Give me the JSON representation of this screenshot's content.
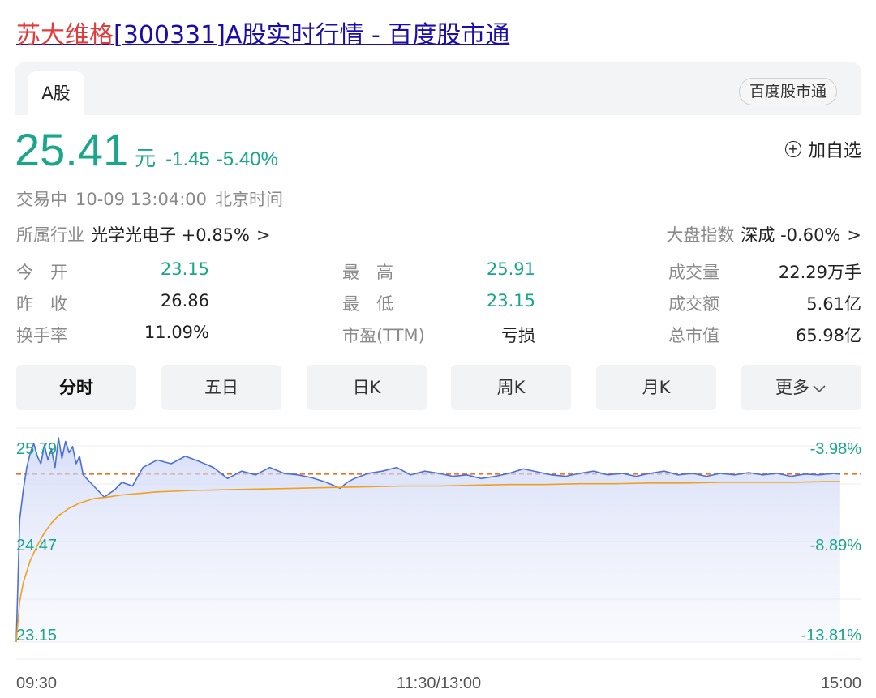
{
  "result_title": {
    "highlight": "苏大维格",
    "rest": "[300331]A股实时行情 - 百度股市通"
  },
  "card": {
    "tab_label": "A股",
    "source_badge": "百度股市通"
  },
  "quote": {
    "price": "25.41",
    "unit": "元",
    "change": "-1.45",
    "change_pct": "-5.40%",
    "watchlist_label": "加自选",
    "status": "交易中",
    "datetime": "10-09 13:04:00",
    "timezone": "北京时间"
  },
  "industry": {
    "label": "所属行业",
    "name": "光学光电子",
    "change": "+0.85%",
    "chevron": ">"
  },
  "market_index": {
    "label": "大盘指数",
    "name": "深成",
    "change": "-0.60%",
    "chevron": ">"
  },
  "stats": {
    "open": {
      "label": "今　开",
      "value": "23.15"
    },
    "prev": {
      "label": "昨　收",
      "value": "26.86"
    },
    "turnover": {
      "label": "换手率",
      "value": "11.09%"
    },
    "high": {
      "label": "最　高",
      "value": "25.91"
    },
    "low": {
      "label": "最　低",
      "value": "23.15"
    },
    "pe": {
      "label": "市盈(TTM)",
      "value": "亏损"
    },
    "volume": {
      "label": "成交量",
      "value": "22.29万手"
    },
    "amount": {
      "label": "成交额",
      "value": "5.61亿"
    },
    "mktcap": {
      "label": "总市值",
      "value": "65.98亿"
    }
  },
  "tabs": [
    "分时",
    "五日",
    "日K",
    "周K",
    "月K",
    "更多"
  ],
  "colors": {
    "down_green": "#1aa68a",
    "price_line": "#4a6fd8",
    "avg_line": "#f0a020",
    "reference_line": "#f07020"
  },
  "chart_data": {
    "type": "line",
    "title": "",
    "xlabel": "",
    "ylabel": "",
    "x_ticks": [
      "09:30",
      "11:30/13:00",
      "15:00"
    ],
    "y_ticks_left": [
      "25.79",
      "24.47",
      "23.15"
    ],
    "y_ticks_right": [
      "-3.98%",
      "-8.89%",
      "-13.81%"
    ],
    "ylim": [
      23.15,
      25.79
    ],
    "reference": 25.41,
    "session_minutes": 240,
    "series": [
      {
        "x": [
          0,
          1,
          2,
          3,
          4,
          5,
          6,
          7,
          8,
          9,
          10,
          11,
          12,
          13,
          14,
          15,
          16,
          17,
          18,
          19,
          20,
          22,
          25,
          28,
          30,
          33,
          36,
          40,
          44,
          48,
          52,
          56,
          60,
          64,
          68,
          72,
          76,
          80,
          84,
          88,
          92,
          94,
          96,
          100,
          104,
          108,
          112,
          116,
          120,
          124,
          128,
          132,
          136,
          140,
          144,
          148,
          152,
          156,
          160,
          164,
          168,
          172,
          176,
          180,
          184,
          188,
          192,
          196,
          200,
          204,
          208,
          212,
          216,
          220,
          224,
          228,
          232,
          234
        ],
        "values": [
          23.15,
          24.8,
          25.2,
          25.5,
          25.7,
          25.82,
          25.65,
          25.55,
          25.8,
          25.6,
          25.75,
          25.5,
          25.9,
          25.62,
          25.85,
          25.7,
          25.78,
          25.55,
          25.65,
          25.4,
          25.35,
          25.25,
          25.1,
          25.2,
          25.3,
          25.25,
          25.5,
          25.6,
          25.55,
          25.65,
          25.58,
          25.5,
          25.35,
          25.45,
          25.4,
          25.5,
          25.42,
          25.4,
          25.36,
          25.3,
          25.22,
          25.3,
          25.35,
          25.42,
          25.45,
          25.5,
          25.4,
          25.45,
          25.42,
          25.38,
          25.4,
          25.35,
          25.38,
          25.42,
          25.48,
          25.44,
          25.4,
          25.38,
          25.42,
          25.45,
          25.4,
          25.42,
          25.38,
          25.42,
          25.45,
          25.4,
          25.42,
          25.38,
          25.42,
          25.4,
          25.43,
          25.4,
          25.42,
          25.38,
          25.41,
          25.4,
          25.42,
          25.41
        ]
      },
      {
        "x": [
          0,
          1,
          2,
          3,
          4,
          5,
          6,
          8,
          10,
          12,
          15,
          18,
          22,
          26,
          30,
          35,
          40,
          50,
          60,
          70,
          80,
          90,
          100,
          110,
          120,
          130,
          140,
          150,
          160,
          170,
          180,
          190,
          200,
          210,
          220,
          230,
          234
        ],
        "values": [
          23.15,
          23.7,
          23.95,
          24.1,
          24.25,
          24.35,
          24.45,
          24.62,
          24.75,
          24.85,
          24.95,
          25.02,
          25.08,
          25.1,
          25.13,
          25.15,
          25.17,
          25.19,
          25.2,
          25.21,
          25.22,
          25.23,
          25.24,
          25.25,
          25.25,
          25.26,
          25.27,
          25.27,
          25.28,
          25.28,
          25.29,
          25.29,
          25.3,
          25.3,
          25.3,
          25.31,
          25.31
        ]
      }
    ]
  }
}
